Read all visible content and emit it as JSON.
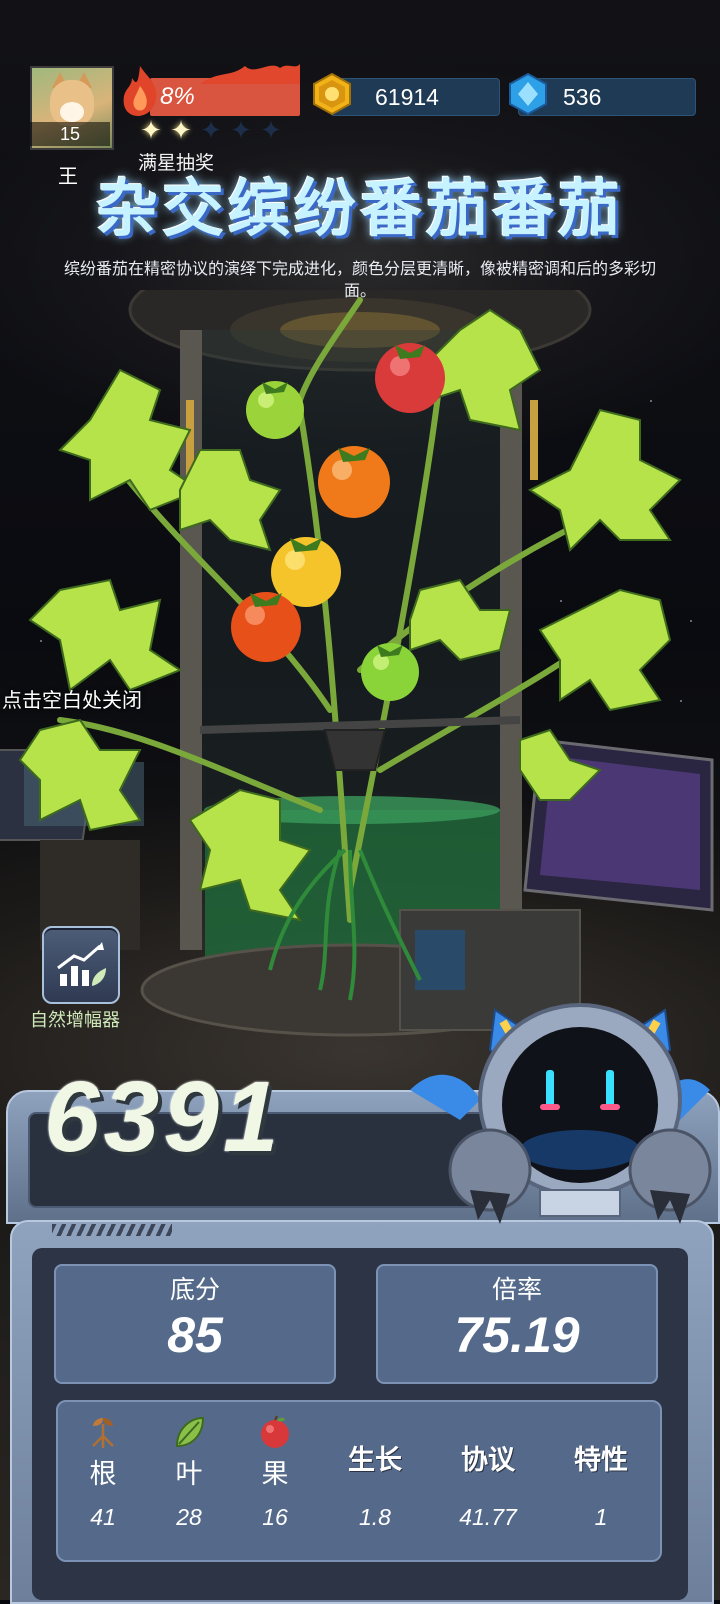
{
  "player": {
    "level": "15"
  },
  "fire": {
    "percent": "8%",
    "star_count": 2,
    "star_total": 5,
    "full_star_label": "满星抽奖"
  },
  "currency": {
    "coins": "61914",
    "gems": "536"
  },
  "title": {
    "rank_tag": "王",
    "name": "杂交缤纷番茄番茄",
    "description": "缤纷番茄在精密协议的演绎下完成进化，颜色分层更清晰，像被精密调和后的多彩切面。"
  },
  "hint": {
    "close": "点击空白处关闭"
  },
  "amplifier": {
    "label": "自然增幅器",
    "icon": "growth-chart-icon"
  },
  "score": {
    "total": "6391"
  },
  "stats": {
    "base": {
      "label": "底分",
      "value": "85"
    },
    "multiplier": {
      "label": "倍率",
      "value": "75.19"
    }
  },
  "attributes": [
    {
      "icon": "sprout-root-icon",
      "label": "根",
      "value": "41"
    },
    {
      "icon": "leaf-icon",
      "label": "叶",
      "value": "28"
    },
    {
      "icon": "apple-fruit-icon",
      "label": "果",
      "value": "16"
    },
    {
      "icon": "",
      "label": "生长",
      "value": "1.8"
    },
    {
      "icon": "",
      "label": "协议",
      "value": "41.77"
    },
    {
      "icon": "",
      "label": "特性",
      "value": "1"
    }
  ],
  "colors": {
    "fire_bar": "#d9553f",
    "currency_bg": "#1f3a55",
    "panel": "#556a8a",
    "title": "#c7f2ff",
    "amp_label": "#cfe9b9"
  }
}
